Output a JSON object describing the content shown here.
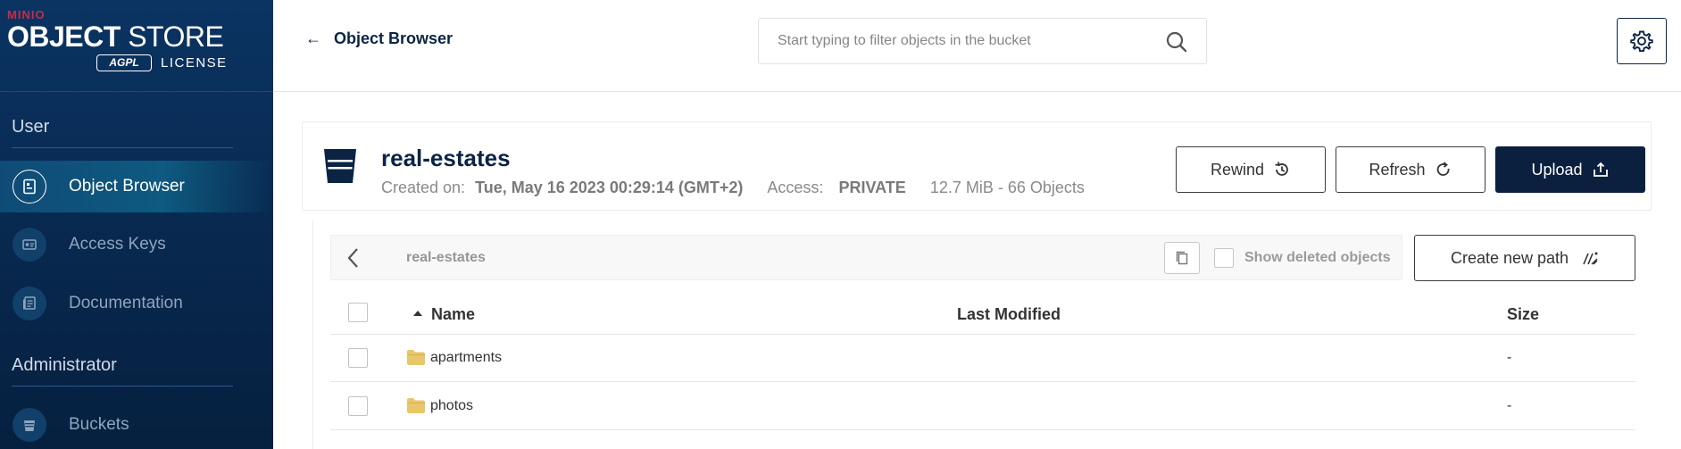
{
  "sidebar": {
    "logo": {
      "brand": "MINIO",
      "title_bold": "OBJECT",
      "title_rest": " STORE",
      "badge": "AGPL",
      "license": "LICENSE"
    },
    "sections": [
      {
        "title": "User",
        "items": [
          {
            "label": "Object Browser",
            "icon": "object-browser-icon",
            "active": true
          },
          {
            "label": "Access Keys",
            "icon": "access-keys-icon",
            "active": false
          },
          {
            "label": "Documentation",
            "icon": "documentation-icon",
            "active": false
          }
        ]
      },
      {
        "title": "Administrator",
        "items": [
          {
            "label": "Buckets",
            "icon": "buckets-icon",
            "active": false
          }
        ]
      }
    ]
  },
  "topbar": {
    "back_label": "Object Browser",
    "search_placeholder": "Start typing to filter objects in the bucket"
  },
  "bucket": {
    "name": "real-estates",
    "created_label": "Created on:",
    "created_value": "Tue, May 16 2023 00:29:14 (GMT+2)",
    "access_label": "Access:",
    "access_value": "PRIVATE",
    "summary": "12.7 MiB - 66 Objects",
    "buttons": {
      "rewind": "Rewind",
      "refresh": "Refresh",
      "upload": "Upload"
    }
  },
  "browser": {
    "path": "real-estates",
    "show_deleted_label": "Show deleted objects",
    "create_path_label": "Create new path",
    "columns": {
      "name": "Name",
      "last_modified": "Last Modified",
      "size": "Size"
    },
    "rows": [
      {
        "name": "apartments",
        "last_modified": "",
        "size": "-"
      },
      {
        "name": "photos",
        "last_modified": "",
        "size": "-"
      }
    ]
  },
  "colors": {
    "sidebar": "#0b3463",
    "primary": "#0b1f3f",
    "accent": "#c72c48",
    "folder": "#e8c66a"
  }
}
